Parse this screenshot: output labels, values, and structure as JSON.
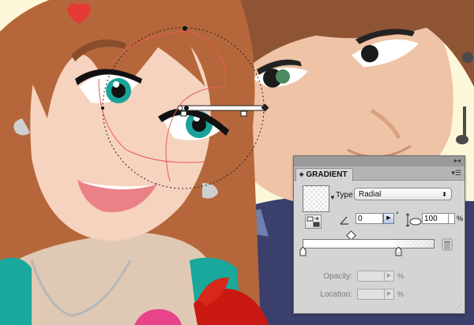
{
  "panel": {
    "title": "GRADIENT",
    "type_label": "Type",
    "type_value": "Radial",
    "angle_value": "0",
    "degree_symbol": "°",
    "aspect_value": "100",
    "percent_symbol": "%",
    "opacity_label": "Opacity:",
    "location_label": "Location:",
    "icons": {
      "tab_arrows": "double-triangle-icon",
      "menu": "panel-menu-icon",
      "reverse": "reverse-gradient-icon",
      "angle": "angle-icon",
      "aspect": "aspect-ratio-icon",
      "trash": "trash-icon",
      "midpoint": "midpoint-diamond-icon"
    }
  },
  "colors": {
    "background": "#fdf7d9",
    "hair_girl": "#b5673b",
    "skin_girl": "#f6d3bf",
    "skin_boy": "#efc3a6",
    "hair_boy": "#8e5434",
    "shirt_boy": "#3a3f6b",
    "eye": "#1ba39a",
    "lips": "#e98187",
    "panel_bg": "#d4d4d4"
  }
}
